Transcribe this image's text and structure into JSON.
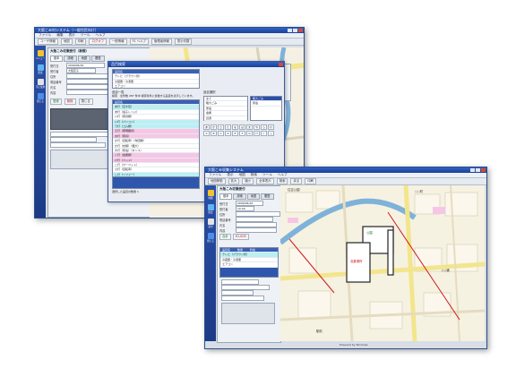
{
  "win1": {
    "title": "大阪こみ村システム（一般住民向け）",
    "menu": [
      "ファイル",
      "編集",
      "表示",
      "ツール",
      "ヘルプ"
    ],
    "toolbar": [
      "ユーザ情報",
      "地図",
      "印刷",
      "ログオフ",
      "一般情報",
      "F1 ヘルプ",
      "管理者情報",
      "表示切替"
    ],
    "side_items": [
      "メニュー",
      "照会",
      "不正使用",
      "閉じる"
    ],
    "form_title": "大阪こみ収集受付（新規）",
    "tabs": [
      "基本",
      "詳細",
      "地図",
      "履歴"
    ],
    "fields": [
      "受付日",
      "受付者",
      "住所",
      "電話番号",
      "氏名",
      "内容"
    ],
    "values": {
      "date": "2009/06/16",
      "name": "大阪花子"
    },
    "action_buttons": [
      "登録",
      "削除",
      "閉じる"
    ],
    "right_panel": {
      "label1": "検索範囲",
      "label2": "対象件数",
      "value1": "1 件",
      "value2": "1 件",
      "value3": "0.8 件",
      "value4": "1,000 件"
    }
  },
  "dlg": {
    "title": "品目検索",
    "top_rows": [
      "テレビ（ブラウン管）",
      "冷蔵庫・冷凍庫",
      "エアコン"
    ],
    "section_label": "品目一覧",
    "hint": "検索　全件数 287 件中 検索条件に合致する品目を表示しています。",
    "list_header": "品目名",
    "list_items": [
      "あ行（空き缶）",
      "あ行（電子レンジ）",
      "い行（家具類）",
      "い行（パソコン）",
      "う行（ゴム類）",
      "え行（照明器具）",
      "お行（家具）",
      "か行（自転車）（布団類）",
      "か行（衣類）（粗大）",
      "き行（家電）（タンス）",
      "く行（金属類）",
      "け行（ベッド）",
      "こ行（カーペット）",
      "さ行（自転車）",
      "し行（ソファー）",
      "す行（ストーブ）",
      "せ行（その他）"
    ],
    "right_title": "品目選択",
    "right_options": [
      "全て",
      "粗大ごみ",
      "家電",
      "金属",
      "資源"
    ],
    "keypad": [
      "あ",
      "か",
      "さ",
      "た",
      "な",
      "は",
      "ま",
      "や",
      "ら",
      "わ",
      "A",
      "B",
      "C",
      "D",
      "E",
      "F",
      "G",
      "H",
      "I",
      "J"
    ],
    "footer": "選択した品目の数量 1",
    "ok": "OK",
    "cancel": "キャンセル"
  },
  "win2": {
    "title": "大阪こみ収集システム",
    "menu": [
      "ファイル",
      "表示",
      "地図",
      "検索",
      "ツール",
      "ヘルプ"
    ],
    "toolbar": [
      "地図移動",
      "拡大",
      "縮小",
      "全体表示",
      "検索",
      "戻る",
      "印刷"
    ],
    "side_items": [
      "地図",
      "照会",
      "受付",
      "閉じる"
    ],
    "form_title": "大阪こみ収集受付",
    "tabs": [
      "基本",
      "詳細",
      "地図",
      "履歴",
      "品目"
    ],
    "fields": [
      "受付日",
      "受付者",
      "住所",
      "電話番号",
      "氏名",
      "内容"
    ],
    "values": {
      "date": "2009/06/16",
      "time": "10:00"
    },
    "table_header": [
      "品目名",
      "数量",
      "料金"
    ],
    "table_rows": [
      "テレビ（ブラウン管）",
      "冷蔵庫・冷凍庫",
      "エアコン"
    ],
    "total_label": "合計",
    "total_value": "¥1,000",
    "map_labels": [
      "住吉公園",
      "○○町",
      "△△通",
      "公園",
      "駅前"
    ],
    "map_mark_text": "収集場所",
    "status": "Powered by Windows"
  },
  "colors": {
    "title": "#1f4aa8",
    "accent": "#ce1b1b",
    "water": "#7fb2d9",
    "road": "#f3e58d"
  }
}
